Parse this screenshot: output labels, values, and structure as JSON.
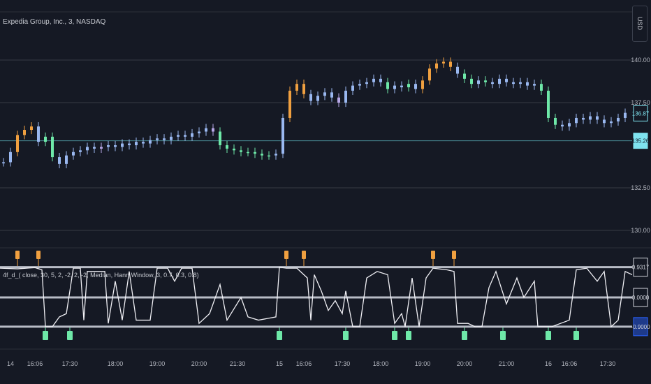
{
  "header": {
    "symbol_title": "Expedia Group, Inc., 3, NASDAQ",
    "currency": "USD"
  },
  "indicator": {
    "title": "4f_d_( close, 30, 5, 2, -2, 2, -2, Median, Hann Window, 3, 0.7, 0.3, 0.8)"
  },
  "chart_data": [
    {
      "type": "candlestick",
      "title": "Expedia Group, Inc., 3, NASDAQ",
      "ylim": [
        129.2,
        141.5
      ],
      "y_ticks": [
        "140.00",
        "137.50",
        "132.50",
        "130.00"
      ],
      "y_tick_values": [
        140,
        137.5,
        132.5,
        130
      ],
      "price_badges": [
        {
          "label": "136.87",
          "value": 136.87,
          "style": "outline"
        },
        {
          "label": "135.26",
          "value": 135.26,
          "style": "filled"
        }
      ],
      "colors": {
        "b": "#9ab8f0",
        "g": "#6ee8a8",
        "o": "#f0a040",
        "p": "#b8a8e8",
        "accent": "#7fe3ef"
      },
      "closes": [
        134.0,
        134.6,
        135.6,
        135.9,
        136.1,
        135.2,
        135.5,
        134.3,
        133.9,
        134.4,
        134.6,
        134.7,
        134.9,
        134.8,
        134.9,
        135.0,
        134.9,
        135.1,
        135.0,
        135.2,
        135.1,
        135.3,
        135.4,
        135.3,
        135.5,
        135.6,
        135.5,
        135.7,
        135.8,
        136.0,
        135.8,
        135.0,
        134.8,
        134.7,
        134.6,
        134.6,
        134.5,
        134.4,
        134.4,
        134.5,
        136.6,
        138.2,
        138.6,
        138.0,
        137.6,
        137.9,
        138.1,
        137.8,
        137.5,
        138.2,
        138.5,
        138.6,
        138.7,
        138.9,
        138.7,
        138.3,
        138.5,
        138.4,
        138.6,
        138.3,
        138.8,
        139.5,
        139.8,
        139.9,
        139.6,
        139.2,
        138.9,
        138.6,
        138.8,
        138.7,
        138.6,
        138.9,
        138.7,
        138.6,
        138.7,
        138.5,
        138.6,
        138.2,
        136.6,
        136.2,
        136.1,
        136.3,
        136.6,
        136.5,
        136.7,
        136.5,
        136.3,
        136.4,
        136.6,
        136.9
      ],
      "bar_colors": "bbooobggbbbbbbpbbbbbbbbbbbbbbbpggggggggbbooobbbbpbbbbbbgbbgbooooobggbgbbbbbbbgggbbbbbbbbbb"
    },
    {
      "type": "line",
      "title": "4f_d_( close, 30, 5, 2, -2, 2, -2, Median, Hann Window, 3, 0.7, 0.3, 0.8)",
      "ylim": [
        -1.2,
        1.25
      ],
      "levels": [
        0.9317,
        0.0,
        -0.9
      ],
      "y_ticks": [
        "0.9317",
        "0.0000",
        "-0.9000"
      ],
      "points": [
        [
          0,
          0.9
        ],
        [
          5,
          0.88
        ],
        [
          10,
          0.92
        ],
        [
          12,
          0.85
        ],
        [
          13,
          -0.9
        ],
        [
          15,
          -0.9
        ],
        [
          17,
          -0.6
        ],
        [
          19,
          -0.5
        ],
        [
          21,
          0.9
        ],
        [
          23,
          0.9
        ],
        [
          24,
          -0.7
        ],
        [
          25,
          0.8
        ],
        [
          30,
          0.8
        ],
        [
          31,
          -0.8
        ],
        [
          33,
          0.5
        ],
        [
          35,
          -0.7
        ],
        [
          37,
          0.8
        ],
        [
          39,
          -0.7
        ],
        [
          43,
          -0.7
        ],
        [
          45,
          0.9
        ],
        [
          48,
          0.9
        ],
        [
          50,
          0.5
        ],
        [
          52,
          0.9
        ],
        [
          55,
          0.9
        ],
        [
          57,
          -0.8
        ],
        [
          60,
          -0.5
        ],
        [
          63,
          0.4
        ],
        [
          65,
          -0.7
        ],
        [
          69,
          0.0
        ],
        [
          71,
          -0.6
        ],
        [
          74,
          -0.7
        ],
        [
          79,
          -0.6
        ],
        [
          80,
          0.93
        ],
        [
          82,
          0.9
        ],
        [
          85,
          0.9
        ],
        [
          88,
          0.6
        ],
        [
          89,
          -0.7
        ],
        [
          90,
          0.7
        ],
        [
          92,
          0.2
        ],
        [
          94,
          -0.4
        ],
        [
          96,
          -0.1
        ],
        [
          98,
          -0.5
        ],
        [
          99,
          0.2
        ],
        [
          101,
          -0.9
        ],
        [
          103,
          -0.9
        ],
        [
          105,
          0.6
        ],
        [
          108,
          0.8
        ],
        [
          111,
          0.7
        ],
        [
          113,
          -0.8
        ],
        [
          115,
          -0.5
        ],
        [
          116,
          -0.9
        ],
        [
          118,
          0.6
        ],
        [
          120,
          -0.9
        ],
        [
          122,
          0.6
        ],
        [
          124,
          0.9
        ],
        [
          128,
          0.85
        ],
        [
          130,
          0.8
        ],
        [
          131,
          -0.8
        ],
        [
          134,
          -0.8
        ],
        [
          136,
          -0.9
        ],
        [
          138,
          -0.9
        ],
        [
          140,
          0.3
        ],
        [
          142,
          0.8
        ],
        [
          145,
          -0.2
        ],
        [
          148,
          0.6
        ],
        [
          150,
          0.0
        ],
        [
          153,
          0.5
        ],
        [
          154,
          -0.9
        ],
        [
          158,
          -0.9
        ],
        [
          163,
          -0.7
        ],
        [
          165,
          0.85
        ],
        [
          168,
          0.9
        ],
        [
          171,
          0.5
        ],
        [
          173,
          0.8
        ],
        [
          175,
          -0.9
        ],
        [
          177,
          -0.7
        ],
        [
          179,
          0.8
        ],
        [
          181,
          0.7
        ]
      ],
      "sell_signals": [
        5,
        11,
        82,
        87,
        124,
        130
      ],
      "buy_signals": [
        13,
        20,
        80,
        99,
        113,
        117,
        133,
        144,
        157,
        165
      ]
    }
  ],
  "x_axis": {
    "labels": [
      {
        "label": "14",
        "bar": 3
      },
      {
        "label": "16:06",
        "bar": 10
      },
      {
        "label": "17:30",
        "bar": 20
      },
      {
        "label": "18:00",
        "bar": 33
      },
      {
        "label": "19:00",
        "bar": 45
      },
      {
        "label": "20:00",
        "bar": 57
      },
      {
        "label": "21:30",
        "bar": 68
      },
      {
        "label": "15",
        "bar": 80
      },
      {
        "label": "16:06",
        "bar": 87
      },
      {
        "label": "17:30",
        "bar": 98
      },
      {
        "label": "18:00",
        "bar": 109
      },
      {
        "label": "19:00",
        "bar": 121
      },
      {
        "label": "20:00",
        "bar": 133
      },
      {
        "label": "21:00",
        "bar": 145
      },
      {
        "label": "16",
        "bar": 157
      },
      {
        "label": "16:06",
        "bar": 163
      },
      {
        "label": "17:30",
        "bar": 174
      }
    ]
  }
}
